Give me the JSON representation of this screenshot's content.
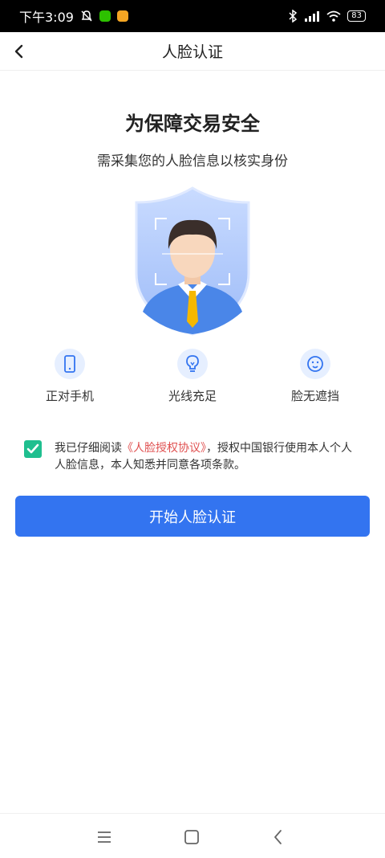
{
  "status_bar": {
    "time": "下午3:09",
    "battery": "83",
    "icons": [
      "bell-off-icon",
      "wechat-icon",
      "notes-icon",
      "bluetooth-icon",
      "signal-icon",
      "wifi-icon"
    ]
  },
  "header": {
    "title": "人脸认证",
    "back_icon": "back-arrow-icon"
  },
  "content": {
    "title": "为保障交易安全",
    "subtitle": "需采集您的人脸信息以核实身份"
  },
  "tips": [
    {
      "label": "正对手机",
      "icon": "phone-icon"
    },
    {
      "label": "光线充足",
      "icon": "lightbulb-icon"
    },
    {
      "label": "脸无遮挡",
      "icon": "face-icon"
    }
  ],
  "agreement": {
    "checked": true,
    "prefix": "我已仔细阅读",
    "link": "《人脸授权协议》",
    "suffix": "，授权中国银行使用本人个人人脸信息，本人知悉并同意各项条款。"
  },
  "start_button": {
    "label": "开始人脸认证"
  },
  "nav": {
    "icons": [
      "menu-icon",
      "home-icon",
      "back-icon"
    ]
  },
  "colors": {
    "primary": "#3374f0",
    "checkbox": "#1fbf8f",
    "link": "#e05050"
  }
}
